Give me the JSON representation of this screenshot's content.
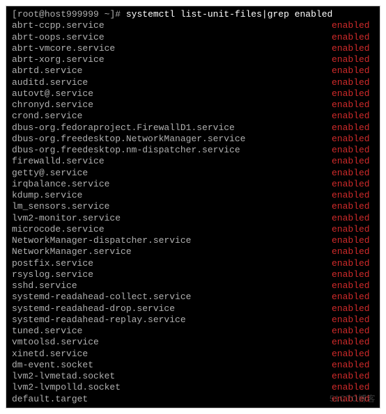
{
  "prompt": {
    "open": "[",
    "user_host": "root@host999999",
    "path": " ~",
    "close": "]#",
    "command": " systemctl list-unit-files|grep enabled"
  },
  "status_label": "enabled",
  "units": [
    {
      "name": "abrt-ccpp.service",
      "status": "enabled"
    },
    {
      "name": "abrt-oops.service",
      "status": "enabled"
    },
    {
      "name": "abrt-vmcore.service",
      "status": "enabled"
    },
    {
      "name": "abrt-xorg.service",
      "status": "enabled"
    },
    {
      "name": "abrtd.service",
      "status": "enabled"
    },
    {
      "name": "auditd.service",
      "status": "enabled"
    },
    {
      "name": "autovt@.service",
      "status": "enabled"
    },
    {
      "name": "chronyd.service",
      "status": "enabled"
    },
    {
      "name": "crond.service",
      "status": "enabled"
    },
    {
      "name": "dbus-org.fedoraproject.FirewallD1.service",
      "status": "enabled"
    },
    {
      "name": "dbus-org.freedesktop.NetworkManager.service",
      "status": "enabled"
    },
    {
      "name": "dbus-org.freedesktop.nm-dispatcher.service",
      "status": "enabled"
    },
    {
      "name": "firewalld.service",
      "status": "enabled"
    },
    {
      "name": "getty@.service",
      "status": "enabled"
    },
    {
      "name": "irqbalance.service",
      "status": "enabled"
    },
    {
      "name": "kdump.service",
      "status": "enabled"
    },
    {
      "name": "lm_sensors.service",
      "status": "enabled"
    },
    {
      "name": "lvm2-monitor.service",
      "status": "enabled"
    },
    {
      "name": "microcode.service",
      "status": "enabled"
    },
    {
      "name": "NetworkManager-dispatcher.service",
      "status": "enabled"
    },
    {
      "name": "NetworkManager.service",
      "status": "enabled"
    },
    {
      "name": "postfix.service",
      "status": "enabled"
    },
    {
      "name": "rsyslog.service",
      "status": "enabled"
    },
    {
      "name": "sshd.service",
      "status": "enabled"
    },
    {
      "name": "systemd-readahead-collect.service",
      "status": "enabled"
    },
    {
      "name": "systemd-readahead-drop.service",
      "status": "enabled"
    },
    {
      "name": "systemd-readahead-replay.service",
      "status": "enabled"
    },
    {
      "name": "tuned.service",
      "status": "enabled"
    },
    {
      "name": "vmtoolsd.service",
      "status": "enabled"
    },
    {
      "name": "xinetd.service",
      "status": "enabled"
    },
    {
      "name": "dm-event.socket",
      "status": "enabled"
    },
    {
      "name": "lvm2-lvmetad.socket",
      "status": "enabled"
    },
    {
      "name": "lvm2-lvmpolld.socket",
      "status": "enabled"
    },
    {
      "name": "default.target",
      "status": "enabled"
    }
  ],
  "watermark": "51CTO博客"
}
